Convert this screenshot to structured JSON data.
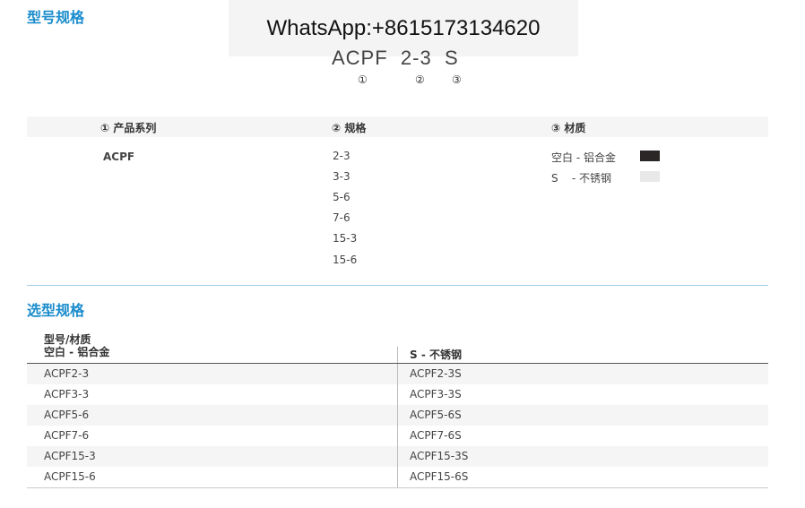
{
  "model_spec": {
    "title": "型号规格"
  },
  "watermark": "WhatsApp:+8615173134620",
  "model_code": {
    "series": "ACPF",
    "size": "2-3",
    "material": "S",
    "markers": [
      "①",
      "②",
      "③"
    ]
  },
  "spec_table": {
    "headers": [
      "① 产品系列",
      "② 规格",
      "③ 材质"
    ],
    "series": "ACPF",
    "sizes": [
      "2-3",
      "3-3",
      "5-6",
      "7-6",
      "15-3",
      "15-6"
    ],
    "materials": [
      {
        "label": "空白 - 铝合金",
        "color": "#2b2727"
      },
      {
        "label": "S    - 不锈钢",
        "color": "#e8e8e8"
      }
    ]
  },
  "selection": {
    "title": "选型规格",
    "header_top": "型号/材质",
    "columns": [
      "空白 - 铝合金",
      "S - 不锈钢"
    ],
    "rows": [
      [
        "ACPF2-3",
        "ACPF2-3S"
      ],
      [
        "ACPF3-3",
        "ACPF3-3S"
      ],
      [
        "ACPF5-6",
        "ACPF5-6S"
      ],
      [
        "ACPF7-6",
        "ACPF7-6S"
      ],
      [
        "ACPF15-3",
        "ACPF15-3S"
      ],
      [
        "ACPF15-6",
        "ACPF15-6S"
      ]
    ]
  },
  "colors": {
    "accent": "#1a8ccc"
  }
}
